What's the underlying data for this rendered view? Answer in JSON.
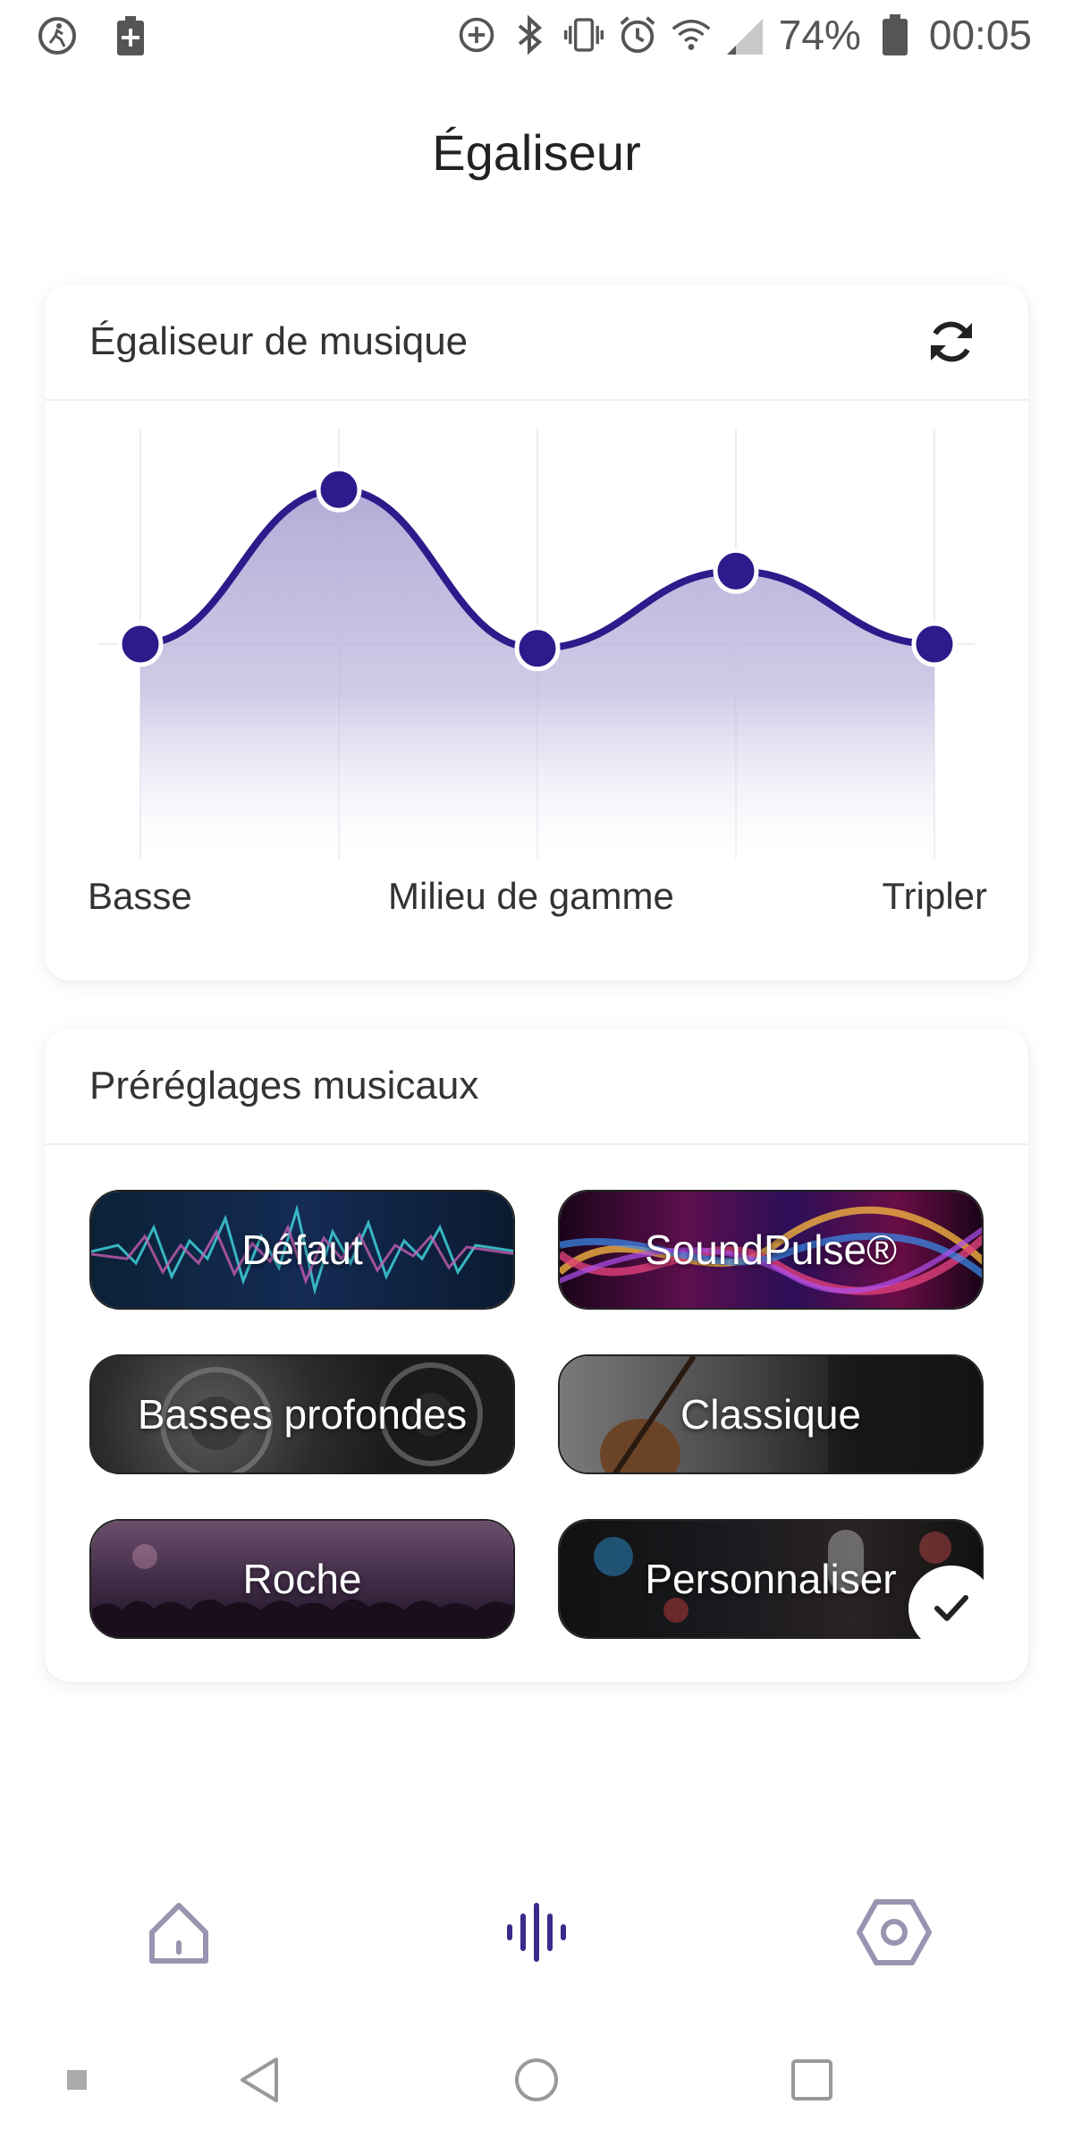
{
  "status_bar": {
    "icons_left": [
      "running-mode-icon",
      "battery-saver-icon"
    ],
    "icons_right": [
      "data-saver-icon",
      "bluetooth-icon",
      "vibrate-icon",
      "alarm-icon",
      "wifi-icon",
      "signal-icon"
    ],
    "battery": "74%",
    "time": "00:05"
  },
  "page": {
    "title": "Égaliseur"
  },
  "equalizer": {
    "title": "Égaliseur de musique",
    "reset_icon": "refresh-icon",
    "accent_color": "#2e1a8a",
    "fill_color": "#b6aed6",
    "levels": [
      0.5,
      0.86,
      0.49,
      0.67,
      0.5
    ],
    "labels": {
      "low": "Basse",
      "mid": "Milieu de gamme",
      "high": "Tripler"
    }
  },
  "presets": {
    "title": "Préréglages musicaux",
    "items": [
      {
        "label": "Défaut",
        "selected": false
      },
      {
        "label": "SoundPulse®",
        "selected": false
      },
      {
        "label": "Basses profondes",
        "selected": false
      },
      {
        "label": "Classique",
        "selected": false
      },
      {
        "label": "Roche",
        "selected": false
      },
      {
        "label": "Personnaliser",
        "selected": true
      }
    ]
  },
  "bottom_nav": {
    "items": [
      {
        "name": "home",
        "icon": "home-icon",
        "active": false
      },
      {
        "name": "equalizer",
        "icon": "equalizer-icon",
        "active": true
      },
      {
        "name": "settings",
        "icon": "settings-icon",
        "active": false
      }
    ],
    "active_color": "#3a2a8c",
    "inactive_color": "#9994b0"
  },
  "system_nav": [
    "back-icon",
    "home-circle-icon",
    "recents-icon"
  ]
}
